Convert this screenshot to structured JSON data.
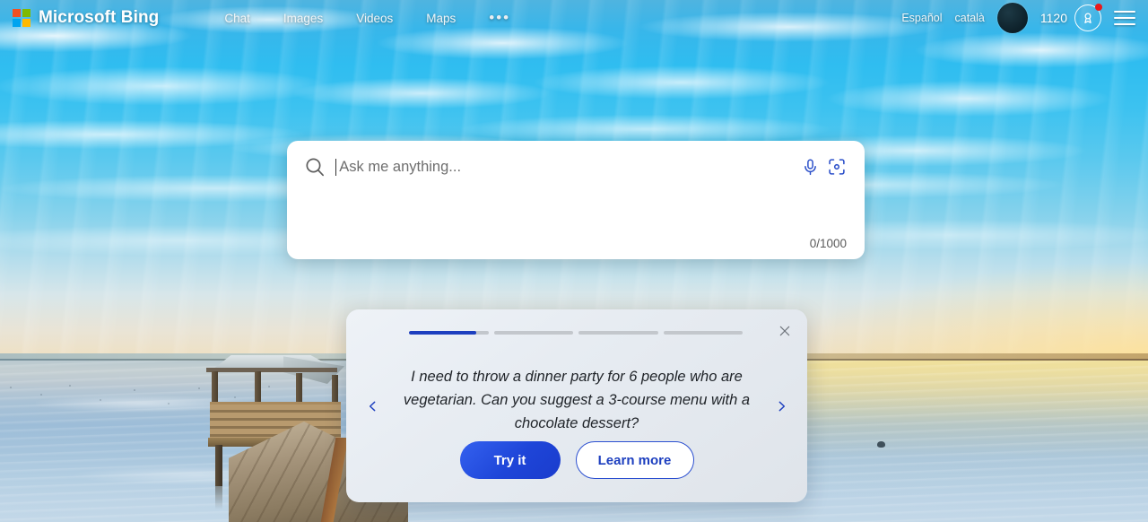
{
  "header": {
    "brand": "Microsoft Bing",
    "logo_colors": [
      "#f25022",
      "#7fba00",
      "#00a4ef",
      "#ffb900"
    ],
    "nav": [
      {
        "label": "Chat",
        "name": "nav-chat"
      },
      {
        "label": "Images",
        "name": "nav-images"
      },
      {
        "label": "Videos",
        "name": "nav-videos"
      },
      {
        "label": "Maps",
        "name": "nav-maps"
      }
    ],
    "more_label": "•••",
    "languages": [
      {
        "label": "Español"
      },
      {
        "label": "català"
      }
    ],
    "rewards_points": "1120",
    "rewards_icon": "rewards-medal-icon",
    "notification_dot_color": "#e8191c",
    "avatar_label": "account-avatar",
    "menu_icon": "hamburger-menu-icon"
  },
  "search": {
    "placeholder": "Ask me anything...",
    "value": "",
    "counter": "0/1000",
    "search_icon": "search-icon",
    "mic_icon": "microphone-icon",
    "visual_search_icon": "visual-search-icon",
    "accent": "#2b4fc9"
  },
  "promo": {
    "prompt": "I need to throw a dinner party for 6 people who are vegetarian. Can you suggest a 3-course menu with a chocolate dessert?",
    "primary_label": "Try it",
    "secondary_label": "Learn more",
    "close_icon": "close-icon",
    "prev_icon": "chevron-left-icon",
    "next_icon": "chevron-right-icon",
    "progress": {
      "total": 4,
      "active_index": 0,
      "active_percent": 85
    },
    "accent": "#1d3fbf"
  },
  "background": {
    "scene": "pier-gazebo-over-calm-water-at-sunset",
    "sky": "#2fbdf0",
    "water": "#a9c2d6",
    "sunset_glow": "#f5e296"
  }
}
